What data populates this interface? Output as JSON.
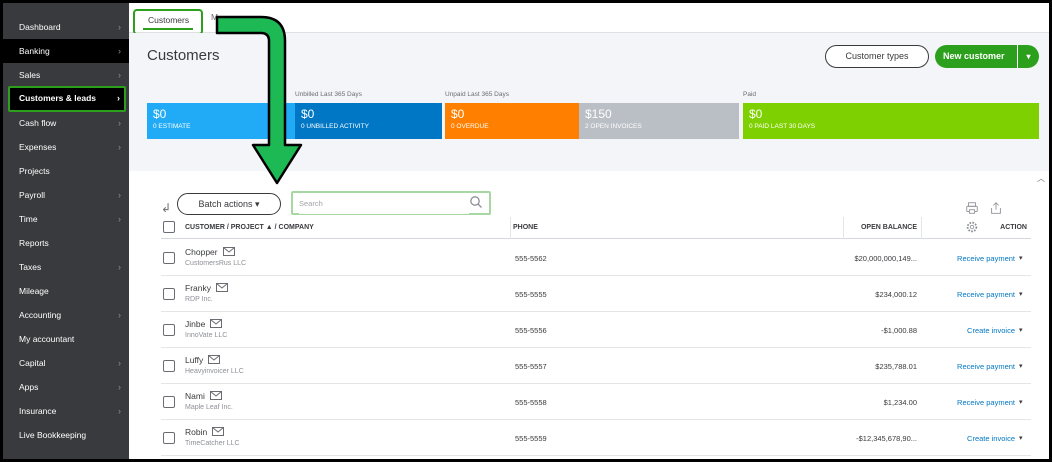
{
  "sidebar": {
    "items": [
      {
        "label": "Dashboard",
        "chevron": true
      },
      {
        "label": "Banking",
        "chevron": true
      },
      {
        "label": "Sales",
        "chevron": true
      },
      {
        "label": "Customers & leads",
        "chevron": true
      },
      {
        "label": "Cash flow",
        "chevron": true
      },
      {
        "label": "Expenses",
        "chevron": true
      },
      {
        "label": "Projects",
        "chevron": false
      },
      {
        "label": "Payroll",
        "chevron": true
      },
      {
        "label": "Time",
        "chevron": true
      },
      {
        "label": "Reports",
        "chevron": false
      },
      {
        "label": "Taxes",
        "chevron": true
      },
      {
        "label": "Mileage",
        "chevron": false
      },
      {
        "label": "Accounting",
        "chevron": true
      },
      {
        "label": "My accountant",
        "chevron": false
      },
      {
        "label": "Capital",
        "chevron": true
      },
      {
        "label": "Apps",
        "chevron": true
      },
      {
        "label": "Insurance",
        "chevron": true
      },
      {
        "label": "Live Bookkeeping",
        "chevron": false
      }
    ],
    "chevron_glyph": "›"
  },
  "tabs": {
    "active": "Customers",
    "second": "M"
  },
  "header": {
    "title": "Customers",
    "customer_types_label": "Customer types",
    "new_customer_label": "New customer",
    "new_customer_dropdown": "▾"
  },
  "money_bar": {
    "labels": {
      "unbilled": "Unbilled Last 365 Days",
      "unpaid": "Unpaid Last 365 Days",
      "paid": "Paid"
    },
    "tiles": [
      {
        "amount": "$0",
        "caption": "0 ESTIMATE",
        "color": "#21abf6"
      },
      {
        "amount": "$0",
        "caption": "0 UNBILLED ACTIVITY",
        "color": "#0077c5"
      },
      {
        "amount": "$0",
        "caption": "0 OVERDUE",
        "color": "#ff8000"
      },
      {
        "amount": "$150",
        "caption": "2 OPEN INVOICES",
        "color": "#babec5"
      },
      {
        "amount": "$0",
        "caption": "0 PAID LAST 30 DAYS",
        "color": "#7fd000"
      }
    ]
  },
  "toolbar": {
    "batch_actions_label": "Batch actions ▾",
    "search_placeholder": "Search"
  },
  "table": {
    "columns": {
      "customer": "CUSTOMER / PROJECT ▲ / COMPANY",
      "phone": "PHONE",
      "balance": "OPEN BALANCE",
      "action": "ACTION"
    },
    "rows": [
      {
        "name": "Chopper",
        "company": "CustomersRus LLC",
        "phone": "555-5562",
        "balance": "$20,000,000,149...",
        "action": "Receive payment"
      },
      {
        "name": "Franky",
        "company": "RDP Inc.",
        "phone": "555-5555",
        "balance": "$234,000.12",
        "action": "Receive payment"
      },
      {
        "name": "Jinbe",
        "company": "InnoVate LLC",
        "phone": "555-5556",
        "balance": "-$1,000.88",
        "action": "Create invoice"
      },
      {
        "name": "Luffy",
        "company": "Heavyinvoicer LLC",
        "phone": "555-5557",
        "balance": "$235,788.01",
        "action": "Receive payment"
      },
      {
        "name": "Nami",
        "company": "Maple Leaf Inc.",
        "phone": "555-5558",
        "balance": "$1,234.00",
        "action": "Receive payment"
      },
      {
        "name": "Robin",
        "company": "TimeCatcher LLC",
        "phone": "555-5559",
        "balance": "-$12,345,678,90...",
        "action": "Create invoice"
      }
    ],
    "action_dropdown": "▾"
  },
  "colors": {
    "accent_green": "#2ca01c",
    "link_blue": "#0077c5",
    "sidebar_bg": "#393a3d"
  }
}
